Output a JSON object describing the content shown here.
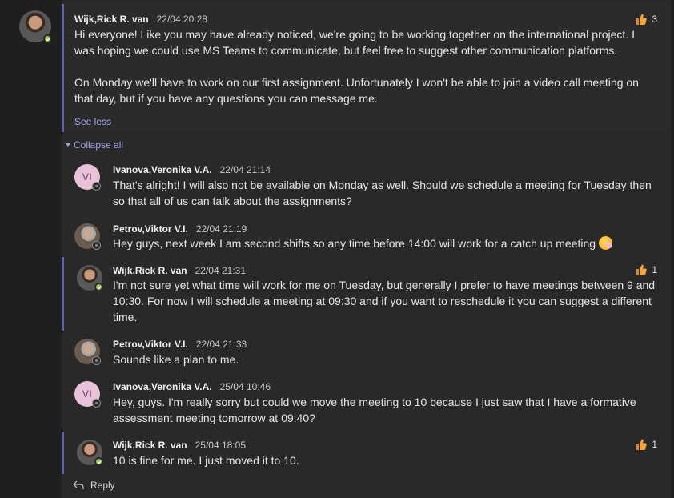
{
  "root": {
    "author": "Wijk,Rick R. van",
    "time": "22/04 20:28",
    "paragraphs": [
      "Hi everyone! Like you may have already noticed, we're going to be working together on the international project. I was hoping we could use MS Teams to communicate, but feel free to suggest other communication platforms.",
      "On Monday we'll have to work on our first assignment. Unfortunately I won't be able to join a video call meeting on that day, but if you have any questions you can message me."
    ],
    "reaction_count": "3",
    "see_less": "See less",
    "presence": "available"
  },
  "collapse_label": "Collapse all",
  "replies": [
    {
      "author": "Ivanova,Veronika V.A.",
      "time": "22/04 21:14",
      "text": "That's alright! I will also not be available on Monday as well. Should we schedule a meeting for Tuesday then so that all of us can talk about the assignments?",
      "initials": "VI",
      "presence": "away"
    },
    {
      "author": "Petrov,Viktor V.I.",
      "time": "22/04 21:19",
      "text": "Hey guys, next week I am second shifts so any time before 14:00 will work for a catch up meeting",
      "presence": "away",
      "emoji": "hand-over-mouth-emoji"
    },
    {
      "author": "Wijk,Rick R. van",
      "time": "22/04 21:31",
      "text": "I'm not sure yet what time will work for me on Tuesday, but generally I prefer to have meetings between 9 and 10:30. For now I will schedule a meeting at 09:30 and if you want to reschedule it you can suggest a different time.",
      "reaction_count": "1",
      "presence": "available"
    },
    {
      "author": "Petrov,Viktor V.I.",
      "time": "22/04 21:33",
      "text": "Sounds like a plan to me.",
      "presence": "away"
    },
    {
      "author": "Ivanova,Veronika V.A.",
      "time": "25/04 10:46",
      "text": "Hey, guys. I'm really sorry but could we move the meeting to 10 because I just saw that I have a formative assessment meeting tomorrow at 09:40?",
      "initials": "VI",
      "presence": "away"
    },
    {
      "author": "Wijk,Rick R. van",
      "time": "25/04 18:05",
      "text": "10 is fine for me. I just moved it to 10.",
      "reaction_count": "1",
      "presence": "available"
    }
  ],
  "reply_label": "Reply",
  "colors": {
    "accent": "#6264a7",
    "link": "#a4a6ef",
    "available": "#92c353",
    "reaction_thumb": "#f2a53a"
  }
}
